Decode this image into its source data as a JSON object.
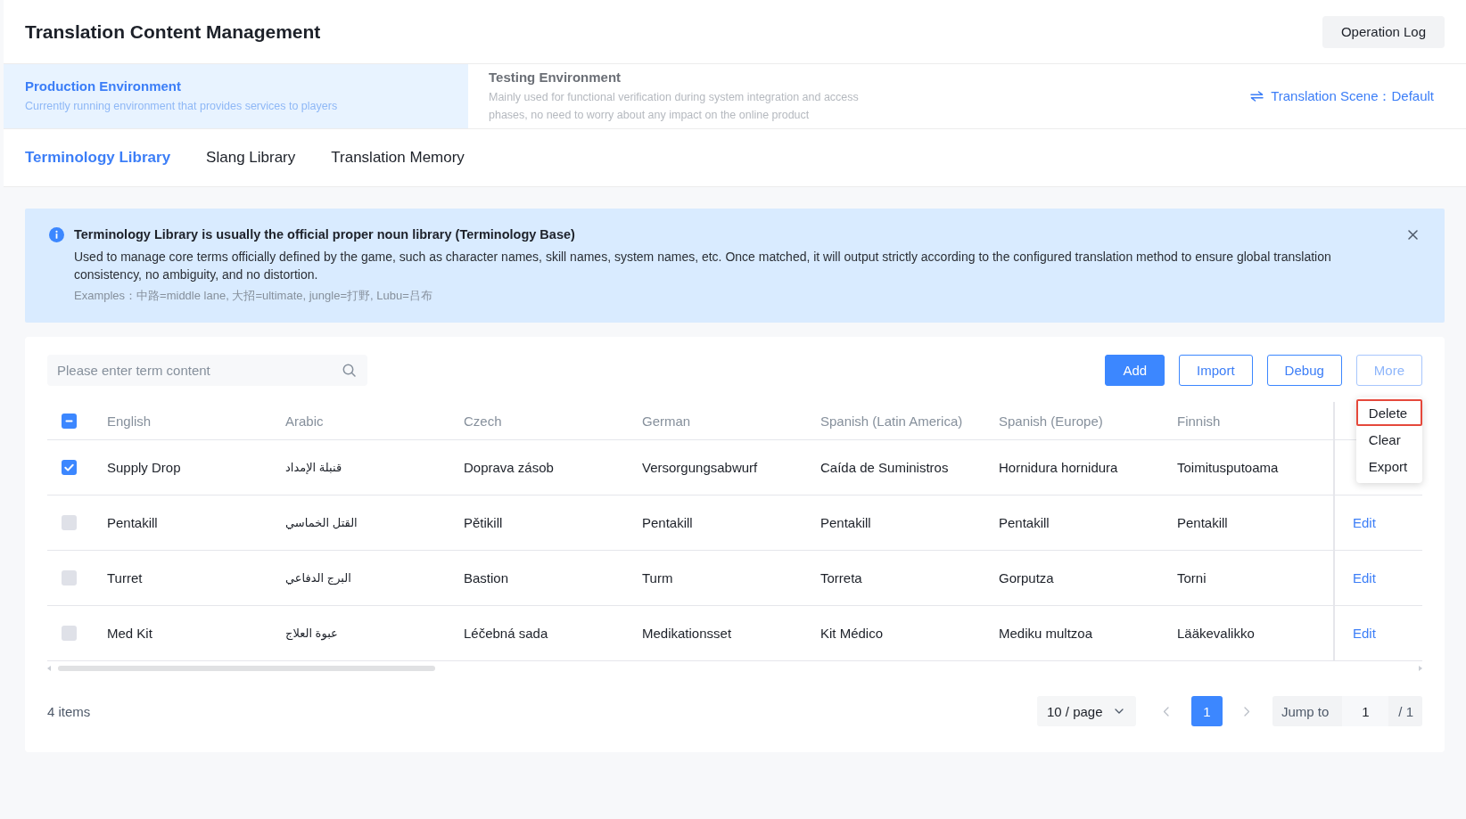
{
  "header": {
    "title": "Translation Content Management",
    "operation_log": "Operation Log"
  },
  "environments": [
    {
      "title": "Production Environment",
      "description": "Currently running environment that provides services to players",
      "selected": true
    },
    {
      "title": "Testing Environment",
      "description": "Mainly used for functional verification during system integration and access phases, no need to worry about any impact on the online product",
      "selected": false
    }
  ],
  "translation_scene": "Translation Scene：Default",
  "tabs": [
    {
      "label": "Terminology Library",
      "selected": true
    },
    {
      "label": "Slang Library",
      "selected": false
    },
    {
      "label": "Translation Memory",
      "selected": false
    }
  ],
  "notice": {
    "title": "Terminology Library is usually the official proper noun library (Terminology Base)",
    "description": "Used to manage core terms officially defined by the game, such as character names, skill names, system names, etc. Once matched, it will output strictly according to the configured translation method to ensure global translation consistency, no ambiguity, and no distortion.",
    "examples": "Examples：中路=middle lane, 大招=ultimate, jungle=打野, Lubu=吕布"
  },
  "toolbar": {
    "search": {
      "placeholder": "Please enter term content"
    },
    "buttons": [
      {
        "label": "Add",
        "kind": "primary",
        "expanded": false
      },
      {
        "label": "Import",
        "kind": "outline",
        "expanded": false
      },
      {
        "label": "Debug",
        "kind": "outline",
        "expanded": false
      },
      {
        "label": "More",
        "kind": "outline",
        "expanded": true,
        "menu": [
          {
            "label": "Delete",
            "selected": true
          },
          {
            "label": "Clear",
            "selected": false
          },
          {
            "label": "Export",
            "selected": false
          }
        ]
      }
    ]
  },
  "table": {
    "select_all": {
      "indeterminate": true
    },
    "columns": [
      "English",
      "Arabic",
      "Czech",
      "German",
      "Spanish (Latin America)",
      "Spanish (Europe)",
      "Finnish"
    ],
    "rows": [
      {
        "checked": true,
        "cells": [
          "Supply Drop",
          "قنبلة الإمداد",
          "Doprava zásob",
          "Versorgungsabwurf",
          "Caída de Suministros",
          "Hornidura hornidura",
          "Toimitusputoama"
        ]
      },
      {
        "checked": false,
        "cells": [
          "Pentakill",
          "القتل الخماسي",
          "Pětikill",
          "Pentakill",
          "Pentakill",
          "Pentakill",
          "Pentakill"
        ],
        "action": "Edit"
      },
      {
        "checked": false,
        "cells": [
          "Turret",
          "البرج الدفاعي",
          "Bastion",
          "Turm",
          "Torreta",
          "Gorputza",
          "Torni"
        ],
        "action": "Edit"
      },
      {
        "checked": false,
        "cells": [
          "Med Kit",
          "عبوة العلاج",
          "Léčebná sada",
          "Medikationsset",
          "Kit Médico",
          "Mediku multzoa",
          "Lääkevalikko"
        ],
        "action": "Edit"
      }
    ]
  },
  "footer": {
    "total": "4 items",
    "page_size": "10 / page",
    "pages": [
      {
        "label": "1",
        "selected": true
      }
    ],
    "jump_label": "Jump to",
    "jump_value": "1",
    "page_count": "/ 1"
  }
}
